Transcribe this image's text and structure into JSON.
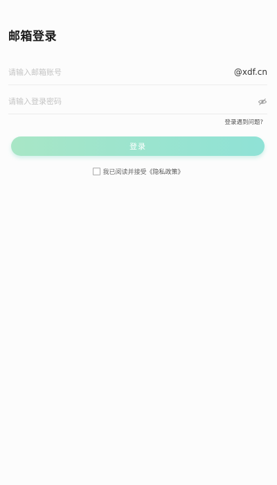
{
  "header": {
    "title": "邮箱登录"
  },
  "email": {
    "placeholder": "请输入邮箱账号",
    "value": "",
    "suffix": "@xdf.cn"
  },
  "password": {
    "placeholder": "请输入登录密码",
    "value": "",
    "toggle_icon": "eye-hidden-icon"
  },
  "forgot_link": "登录遇到问题?",
  "login_button": "登录",
  "agreement": {
    "checked": false,
    "text": "我已阅读并接受",
    "policy_link": "《隐私政策》"
  },
  "colors": {
    "button_gradient_start": "#a8e6c6",
    "button_gradient_end": "#8fe2d6",
    "background": "#fcfcfc"
  }
}
